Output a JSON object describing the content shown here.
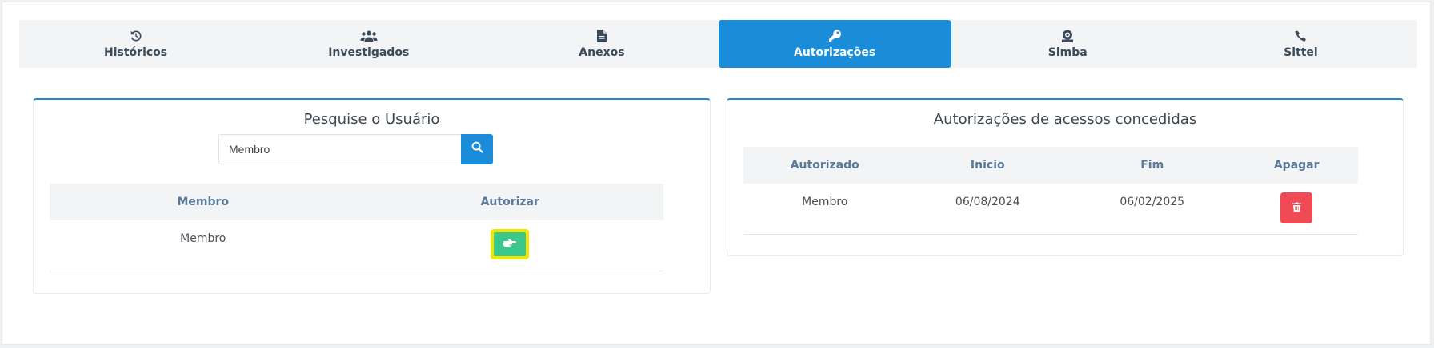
{
  "tabs": [
    {
      "label": "Históricos",
      "icon": "history-icon",
      "active": false
    },
    {
      "label": "Investigados",
      "icon": "users-icon",
      "active": false
    },
    {
      "label": "Anexos",
      "icon": "file-icon",
      "active": false
    },
    {
      "label": "Autorizações",
      "icon": "key-icon",
      "active": true
    },
    {
      "label": "Simba",
      "icon": "coin-icon",
      "active": false
    },
    {
      "label": "Sittel",
      "icon": "phone-icon",
      "active": false
    }
  ],
  "search_panel": {
    "title": "Pesquise o Usuário",
    "search_value": "Membro",
    "search_button_icon": "search-icon",
    "columns": [
      "Membro",
      "Autorizar"
    ],
    "rows": [
      {
        "membro": "Membro",
        "action_icon": "hand-pointer-icon"
      }
    ]
  },
  "authorizations_panel": {
    "title": "Autorizações de acessos concedidas",
    "columns": [
      "Autorizado",
      "Inicio",
      "Fim",
      "Apagar"
    ],
    "rows": [
      {
        "autorizado": "Membro",
        "inicio": "06/08/2024",
        "fim": "06/02/2025",
        "action_icon": "trash-icon"
      }
    ]
  },
  "colors": {
    "accent": "#1a8cd8",
    "authorize_button": "#3cc88a",
    "highlight": "#f2e600",
    "delete_button": "#ef4a55"
  }
}
